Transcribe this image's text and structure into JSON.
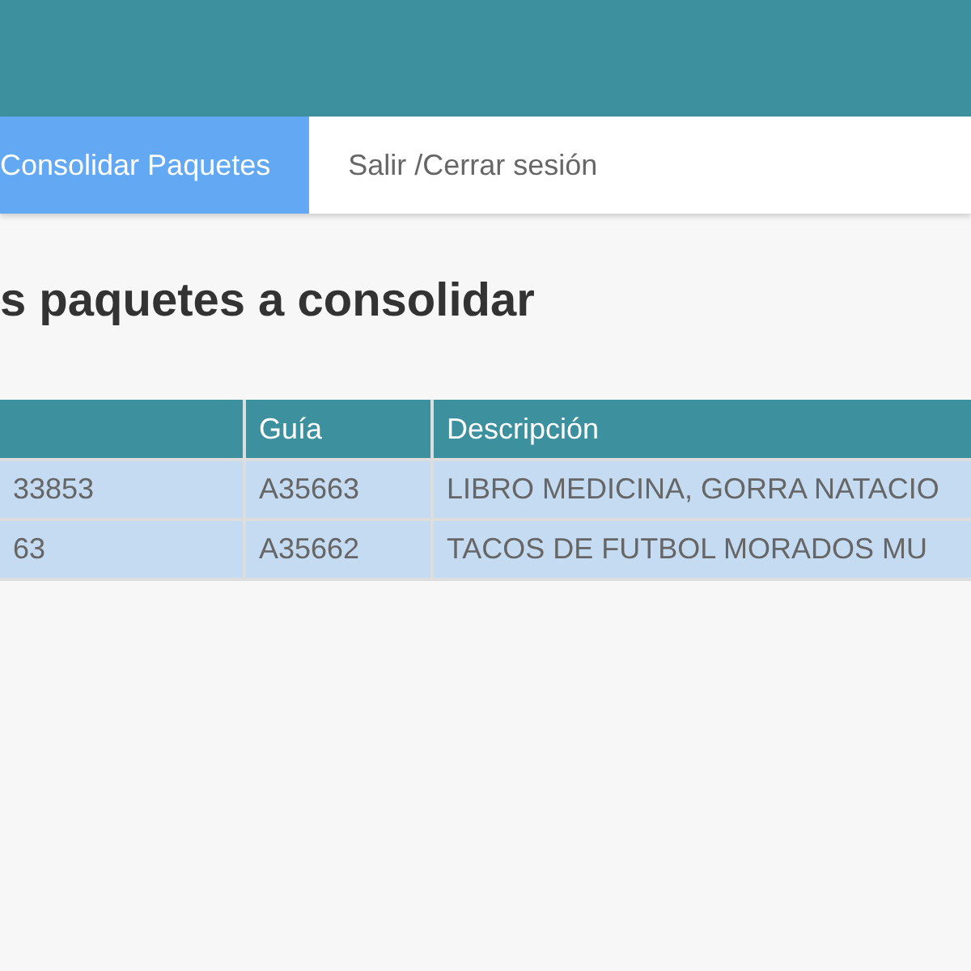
{
  "nav": {
    "items": [
      {
        "label": "Consolidar Paquetes",
        "selected": true
      },
      {
        "label": "Salir /Cerrar sesión",
        "selected": false
      }
    ]
  },
  "heading": "s paquetes a consolidar",
  "table": {
    "columns": [
      "",
      "Guía",
      "Descripción"
    ],
    "rows": [
      [
        "33853",
        "A35663",
        "LIBRO MEDICINA, GORRA NATACIO"
      ],
      [
        "63",
        "A35662",
        "TACOS DE FUTBOL MORADOS MU"
      ]
    ]
  }
}
